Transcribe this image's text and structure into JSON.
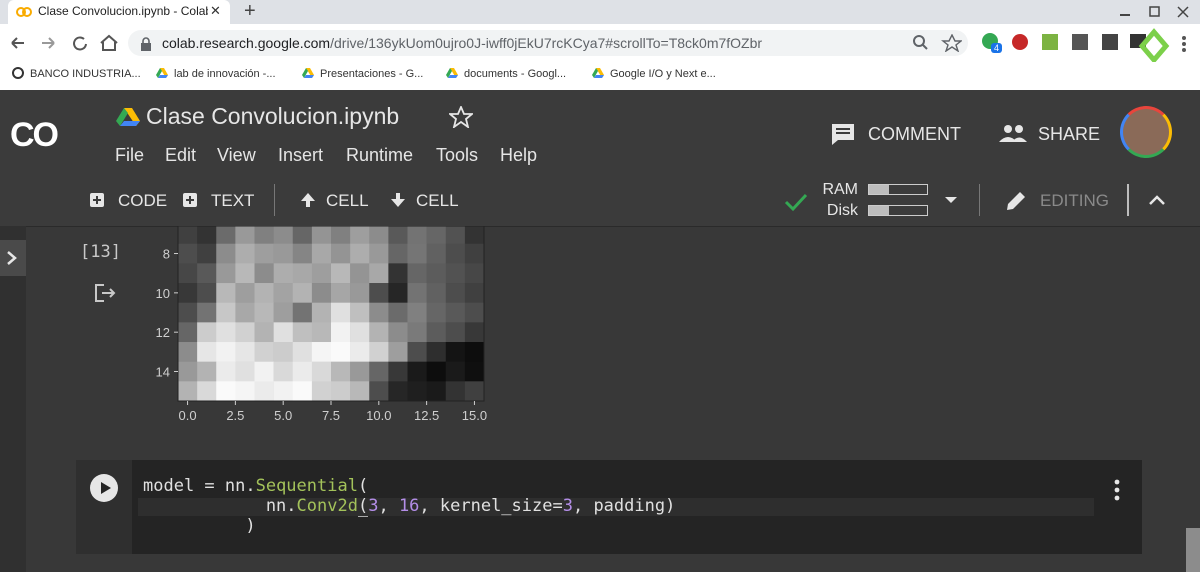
{
  "browser": {
    "tab_title": "Clase Convolucion.ipynb - Colab",
    "tab_close": "✕",
    "new_tab": "+",
    "url_host": "colab.research.google.com",
    "url_path": "/drive/136ykUom0ujro0J-iwff0jEkU7rcKCya7#scrollTo=T8ck0m7fOZbr",
    "extension_badge": "4",
    "bookmarks": [
      {
        "label": "BANCO INDUSTRIA..."
      },
      {
        "label": "lab de innovación -..."
      },
      {
        "label": "Presentaciones - G..."
      },
      {
        "label": "documents - Googl..."
      },
      {
        "label": "Google I/O y Next e..."
      }
    ]
  },
  "colab": {
    "logo": "CO",
    "notebook_title": "Clase Convolucion.ipynb",
    "menu": [
      "File",
      "Edit",
      "View",
      "Insert",
      "Runtime",
      "Tools",
      "Help"
    ],
    "comment_label": "COMMENT",
    "share_label": "SHARE",
    "toolbar": {
      "code_label": "CODE",
      "text_label": "TEXT",
      "cell_up_label": "CELL",
      "cell_down_label": "CELL",
      "ram_label": "RAM",
      "disk_label": "Disk",
      "ram_usage": 0.35,
      "disk_usage": 0.35,
      "editing_label": "EDITING"
    }
  },
  "output_cell": {
    "exec_count": "[13]"
  },
  "chart_data": {
    "type": "heatmap",
    "colormap": "gray",
    "x_ticks": [
      "0.0",
      "2.5",
      "5.0",
      "7.5",
      "10.0",
      "12.5",
      "15.0"
    ],
    "y_ticks": [
      "8",
      "10",
      "12",
      "14"
    ],
    "xlim": [
      -0.5,
      15.5
    ],
    "ylim_visible": [
      6.6,
      15.5
    ],
    "rows_start": 7,
    "values": [
      [
        0.25,
        0.2,
        0.42,
        0.6,
        0.5,
        0.55,
        0.4,
        0.58,
        0.5,
        0.62,
        0.55,
        0.35,
        0.45,
        0.4,
        0.32,
        0.2
      ],
      [
        0.3,
        0.25,
        0.55,
        0.68,
        0.62,
        0.6,
        0.52,
        0.66,
        0.58,
        0.68,
        0.6,
        0.4,
        0.46,
        0.38,
        0.3,
        0.25
      ],
      [
        0.28,
        0.35,
        0.6,
        0.72,
        0.55,
        0.68,
        0.66,
        0.62,
        0.72,
        0.58,
        0.66,
        0.2,
        0.4,
        0.36,
        0.32,
        0.28
      ],
      [
        0.22,
        0.3,
        0.72,
        0.62,
        0.7,
        0.64,
        0.7,
        0.55,
        0.65,
        0.6,
        0.3,
        0.15,
        0.45,
        0.38,
        0.3,
        0.25
      ],
      [
        0.3,
        0.45,
        0.78,
        0.66,
        0.72,
        0.62,
        0.45,
        0.7,
        0.88,
        0.75,
        0.55,
        0.42,
        0.5,
        0.4,
        0.35,
        0.3
      ],
      [
        0.4,
        0.8,
        0.88,
        0.82,
        0.7,
        0.88,
        0.75,
        0.72,
        0.95,
        0.88,
        0.7,
        0.55,
        0.48,
        0.36,
        0.3,
        0.22
      ],
      [
        0.55,
        0.9,
        0.95,
        0.9,
        0.82,
        0.8,
        0.88,
        0.96,
        0.98,
        0.92,
        0.82,
        0.62,
        0.3,
        0.18,
        0.08,
        0.05
      ],
      [
        0.6,
        0.7,
        0.92,
        0.88,
        0.95,
        0.85,
        0.92,
        0.85,
        0.72,
        0.6,
        0.4,
        0.22,
        0.1,
        0.05,
        0.1,
        0.06
      ],
      [
        0.7,
        0.85,
        0.98,
        0.96,
        0.92,
        0.95,
        0.98,
        0.82,
        0.8,
        0.72,
        0.3,
        0.15,
        0.12,
        0.1,
        0.2,
        0.25
      ]
    ]
  },
  "code_cell": {
    "line1": {
      "pre": "model = nn.",
      "fn": "Sequential",
      "post": "("
    },
    "line2": {
      "pre": "            nn.",
      "fn": "Conv2d",
      "open": "(",
      "n1": "3",
      "sep1": ", ",
      "n2": "16",
      "sep2": ", kernel_size=",
      "n3": "3",
      "post": ", padding)"
    },
    "line3": "          )"
  },
  "colors": {
    "accent_green": "#34a853",
    "background": "#383838",
    "function_color": "#a3c25a",
    "number_color": "#b48ee8"
  }
}
